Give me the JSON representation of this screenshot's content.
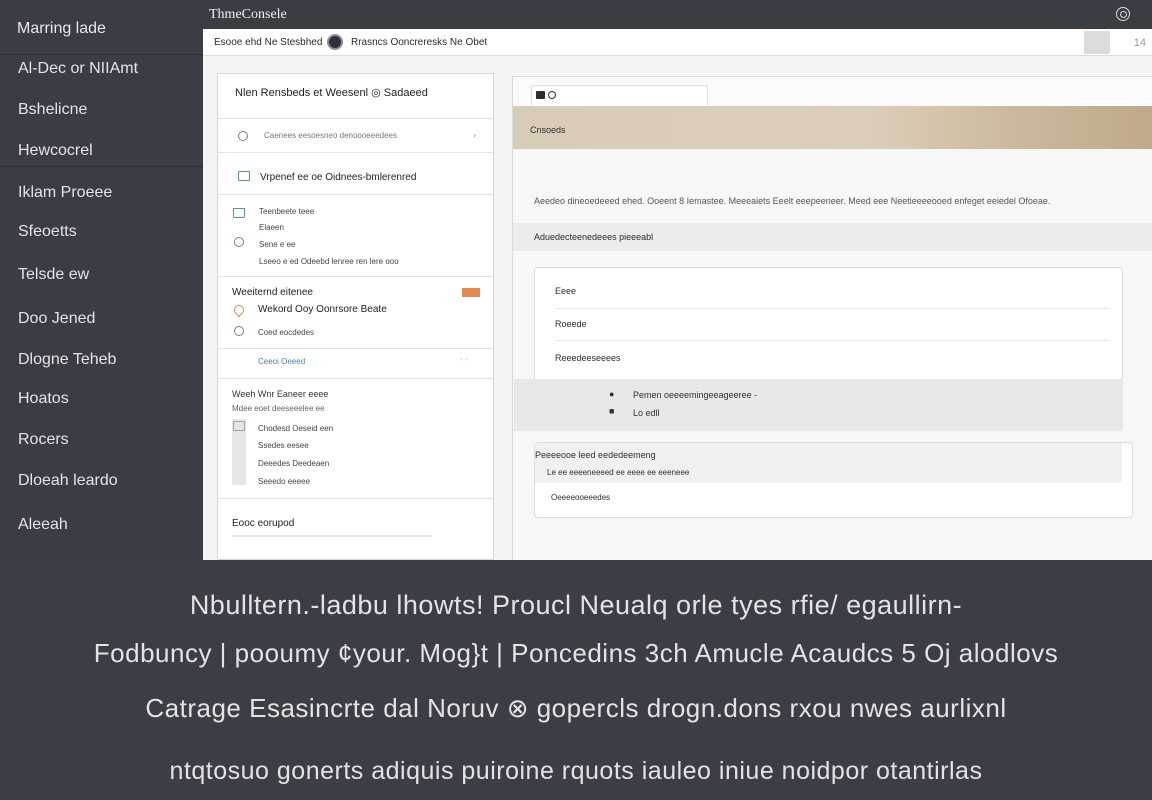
{
  "sidebar": {
    "top_item": "Marring lade",
    "items": [
      "Al-Dec or NIIAmt",
      "Bshelicne",
      "Hewcocrel",
      "Iklam Proeee",
      "Sfeoetts",
      "Telsde ew",
      "Doo Jened",
      "Dlogne Teheb",
      "Hoatos",
      "Rocers",
      "Dloeah leardo",
      "Aleeah"
    ]
  },
  "window": {
    "title": "ThmeConsele",
    "toolbar": {
      "path": "Esooe ehd Ne Stesbhed",
      "site": "Rrasncs Ooncreresks Ne Obet",
      "count": "14"
    }
  },
  "left_panel": {
    "header": "Nlen Rensbeds et Weesenl ◎ Sadaeed",
    "row1": "Caenees eesoesneo denoooeeedees",
    "section2_title": "Vrpenef ee oe Oidnees-bmlerenred",
    "section2_items": [
      "Teenbeete teee",
      "Elaeen",
      "Sene e ee",
      "Lseeo e ed Odeebd lenree ren lere ooo"
    ],
    "section3_title": "Weeiternd eitenee",
    "section3_sub": "Wekord Ooy Oonrsore Beate",
    "section3_note": "Coed eocdedes",
    "section3_link": "Ceeoi Oeeed",
    "section4_title": "Weeh Wnr Eaneer eeee",
    "section4_sub": "Mdee eoet deeseeelee ee",
    "section4_items": [
      "Chodesd Oeseid een",
      "Ssedes eesee",
      "Deeedes Deedeaen",
      "Seeedo eeeee"
    ],
    "section5_title": "Eooc eorupod"
  },
  "right_panel": {
    "banner_label": "Cnsoeds",
    "info_line": "Aeedeo dineoedeeed ehed. Ooeent 8 Iemastee. Meeeaiets Eeelt eeepeeneer. Meed eee Neetieeeeooed enfeget eeiedel Ofoeae.",
    "strip": "Aduedecteenedeees pieeeabl",
    "card1_rows": [
      "Eeee",
      "Roeede",
      "Reeedeeseeees"
    ],
    "card1_grey_line1": "Pemen oeeeemingeeageeree -",
    "card1_grey_line2": "Lo edll",
    "card2_line1": "Peeeeooe leed eededeemeng",
    "card2_line2": "Le ee eeeeneeeed ee eeee ee eeeneee",
    "card2_footer": "Oeeeeooeeedes"
  },
  "caption": {
    "lines": [
      "Nbulltern.-ladbu lhowts! Proucl Neualq orle tyes rfie/ egaullirn-",
      "Fodbuncy | pooumy ¢your. Mog}t | Poncedins 3ch Amucle Acaudcs 5 Oj alodlovs",
      "Catrage Esasincrte dal Noruv ⊗ gopercls drogn.dons rxou nwes aurlixnl",
      "ntqtosuo gonerts adiquis puiroine rquots iauleo iniue noidpor otantirlas"
    ]
  },
  "colors": {
    "app_dark": "#3a3d44",
    "accent_orange": "#e4894b",
    "banner_tan": "#d8ccb6"
  }
}
